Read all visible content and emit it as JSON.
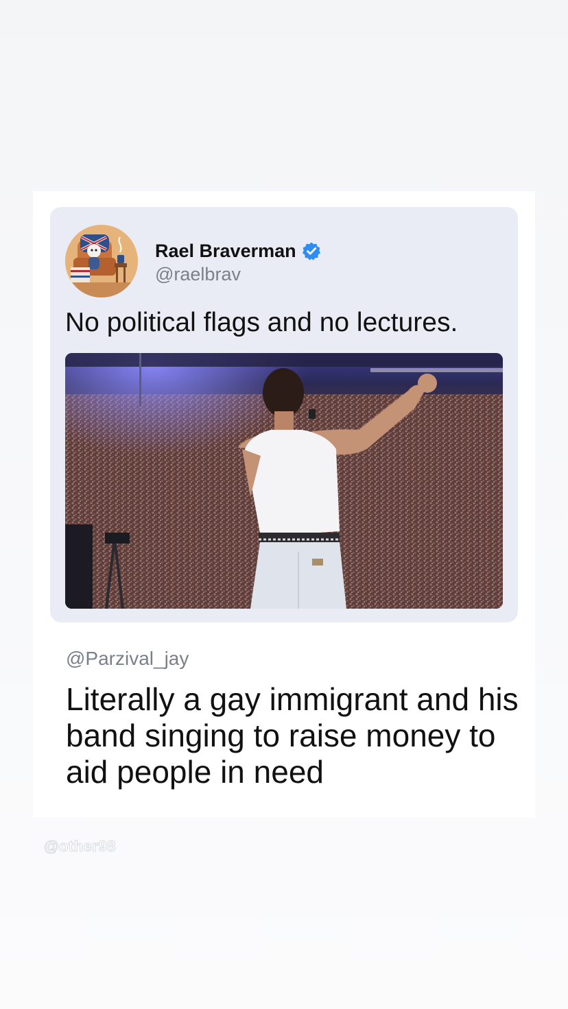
{
  "quoted_post": {
    "author_name": "Rael Braverman",
    "handle": "@raelbrav",
    "verified": true,
    "avatar_icon": "cartoon-figure-armchair-avatar",
    "text": "No political flags and no lectures.",
    "media_icon": "concert-singer-crowd-photo"
  },
  "reply": {
    "handle": "@Parzival_jay",
    "text": "Literally a gay immigrant and his band singing to raise money to aid people in need"
  },
  "watermark": "@other98",
  "colors": {
    "verified": "#2f8df0",
    "quoted_bg": "#e9ecf5",
    "muted_text": "#7b7f87"
  }
}
